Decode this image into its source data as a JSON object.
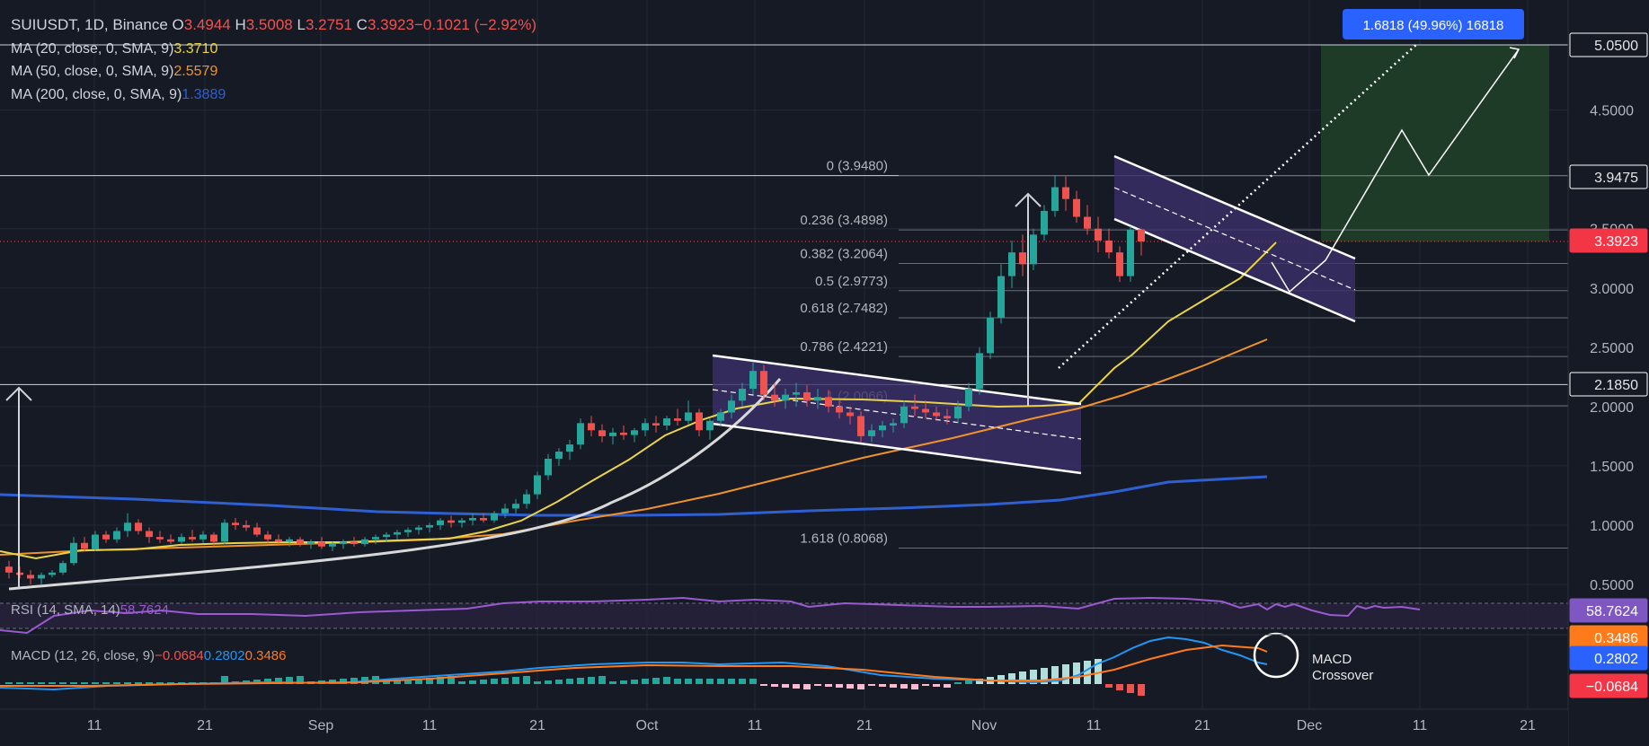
{
  "header": {
    "symbol": "SUIUSDT, 1D, Binance",
    "o_label": "O",
    "o_value": "3.4944",
    "h_label": "H",
    "h_value": "3.5008",
    "l_label": "L",
    "l_value": "3.2751",
    "c_label": "C",
    "c_value": "3.3923",
    "change": "−0.1021 (−2.92%)"
  },
  "indicators": {
    "ma20": {
      "label": "MA (20, close, 0, SMA, 9)",
      "value": "3.3710",
      "color": "#e8d34a"
    },
    "ma50": {
      "label": "MA (50, close, 0, SMA, 9)",
      "value": "2.5579",
      "color": "#f0922b"
    },
    "ma200": {
      "label": "MA (200, close, 0, SMA, 9)",
      "value": "1.3889",
      "color": "#2f5fd0"
    },
    "rsi": {
      "label": "RSI (14, SMA, 14)",
      "value": "58.7624",
      "color": "#9a5ad0"
    },
    "macd": {
      "label": "MACD (12, 26, close, 9)",
      "v1": "−0.0684",
      "v2": "0.2802",
      "v3": "0.3486"
    }
  },
  "colors": {
    "up": "#26a69a",
    "down": "#ef5350",
    "background": "#161a25",
    "target_zone": "#1e3b28",
    "channel": "#3b2f6a"
  },
  "price_axis": {
    "ticks": [
      "5.0500",
      "4.5000",
      "3.9475",
      "3.5000",
      "3.0000",
      "2.5000",
      "2.1850",
      "2.0000",
      "1.5000",
      "1.0000",
      "0.5000"
    ],
    "labels": [
      {
        "text": "5.0500",
        "style": "boxed"
      },
      {
        "text": "3.9475",
        "style": "boxed"
      },
      {
        "text": "3.3923",
        "style": "red"
      },
      {
        "text": "2.1850",
        "style": "boxed"
      },
      {
        "text": "58.7624",
        "style": "purple"
      },
      {
        "text": "0.3486",
        "style": "orange"
      },
      {
        "text": "0.2802",
        "style": "blue"
      },
      {
        "text": "−0.0684",
        "style": "red"
      }
    ]
  },
  "time_axis": [
    "11",
    "21",
    "Sep",
    "11",
    "21",
    "Oct",
    "11",
    "21",
    "Nov",
    "11",
    "21",
    "Dec",
    "11",
    "21"
  ],
  "fib_levels": [
    {
      "label": "0 (3.9480)",
      "price": 3.948
    },
    {
      "label": "0.236 (3.4898)",
      "price": 3.4898
    },
    {
      "label": "0.382 (3.2064)",
      "price": 3.2064
    },
    {
      "label": "0.5 (2.9773)",
      "price": 2.9773
    },
    {
      "label": "0.618 (2.7482)",
      "price": 2.7482
    },
    {
      "label": "0.786 (2.4221)",
      "price": 2.4221
    },
    {
      "label": "1 (2.0066)",
      "price": 2.0066
    },
    {
      "label": "1.618 (0.8068)",
      "price": 0.8068
    }
  ],
  "annotations": {
    "measure_label": "1.6818 (49.96%) 16818",
    "macd_note_line1": "MACD",
    "macd_note_line2": "Crossover"
  },
  "chart_data": {
    "type": "candlestick",
    "symbol": "SUIUSDT",
    "interval": "1D",
    "ylim": [
      0.5,
      5.05
    ],
    "price_levels": [
      5.05,
      3.9475,
      3.3923,
      2.185
    ],
    "last": {
      "open": 3.4944,
      "high": 3.5008,
      "low": 3.2751,
      "close": 3.3923
    },
    "candles": [
      [
        0.65,
        0.7,
        0.55,
        0.6
      ],
      [
        0.6,
        0.65,
        0.55,
        0.58
      ],
      [
        0.58,
        0.62,
        0.5,
        0.55
      ],
      [
        0.55,
        0.6,
        0.5,
        0.58
      ],
      [
        0.58,
        0.62,
        0.56,
        0.6
      ],
      [
        0.6,
        0.7,
        0.58,
        0.68
      ],
      [
        0.68,
        0.9,
        0.66,
        0.85
      ],
      [
        0.85,
        0.9,
        0.78,
        0.8
      ],
      [
        0.8,
        0.95,
        0.78,
        0.92
      ],
      [
        0.92,
        0.95,
        0.85,
        0.88
      ],
      [
        0.88,
        0.98,
        0.85,
        0.95
      ],
      [
        0.95,
        1.1,
        0.9,
        1.02
      ],
      [
        1.02,
        1.05,
        0.92,
        0.95
      ],
      [
        0.95,
        0.98,
        0.85,
        0.9
      ],
      [
        0.9,
        0.95,
        0.85,
        0.88
      ],
      [
        0.88,
        0.92,
        0.84,
        0.86
      ],
      [
        0.86,
        0.93,
        0.84,
        0.9
      ],
      [
        0.9,
        0.96,
        0.86,
        0.88
      ],
      [
        0.88,
        0.95,
        0.85,
        0.92
      ],
      [
        0.92,
        0.94,
        0.82,
        0.86
      ],
      [
        0.86,
        1.05,
        0.84,
        1.02
      ],
      [
        1.02,
        1.06,
        0.96,
        1.0
      ],
      [
        1.0,
        1.04,
        0.95,
        0.98
      ],
      [
        0.98,
        1.02,
        0.9,
        0.92
      ],
      [
        0.92,
        0.95,
        0.85,
        0.88
      ],
      [
        0.88,
        0.92,
        0.84,
        0.86
      ],
      [
        0.86,
        0.9,
        0.82,
        0.88
      ],
      [
        0.88,
        0.9,
        0.82,
        0.84
      ],
      [
        0.84,
        0.88,
        0.8,
        0.86
      ],
      [
        0.86,
        0.9,
        0.8,
        0.82
      ],
      [
        0.82,
        0.86,
        0.78,
        0.84
      ],
      [
        0.84,
        0.88,
        0.8,
        0.86
      ],
      [
        0.86,
        0.9,
        0.82,
        0.84
      ],
      [
        0.84,
        0.9,
        0.82,
        0.88
      ],
      [
        0.88,
        0.92,
        0.84,
        0.9
      ],
      [
        0.9,
        0.94,
        0.86,
        0.92
      ],
      [
        0.92,
        0.96,
        0.88,
        0.94
      ],
      [
        0.94,
        0.98,
        0.9,
        0.96
      ],
      [
        0.96,
        1.0,
        0.92,
        0.98
      ],
      [
        0.98,
        1.02,
        0.94,
        1.0
      ],
      [
        1.0,
        1.06,
        0.96,
        1.04
      ],
      [
        1.04,
        1.08,
        0.98,
        1.02
      ],
      [
        1.02,
        1.06,
        0.98,
        1.04
      ],
      [
        1.04,
        1.1,
        1.0,
        1.06
      ],
      [
        1.06,
        1.1,
        1.02,
        1.04
      ],
      [
        1.04,
        1.12,
        1.02,
        1.1
      ],
      [
        1.1,
        1.18,
        1.06,
        1.14
      ],
      [
        1.14,
        1.22,
        1.1,
        1.18
      ],
      [
        1.18,
        1.3,
        1.14,
        1.26
      ],
      [
        1.26,
        1.45,
        1.22,
        1.42
      ],
      [
        1.42,
        1.6,
        1.38,
        1.56
      ],
      [
        1.56,
        1.65,
        1.5,
        1.62
      ],
      [
        1.62,
        1.72,
        1.55,
        1.68
      ],
      [
        1.68,
        1.9,
        1.64,
        1.86
      ],
      [
        1.86,
        1.92,
        1.75,
        1.8
      ],
      [
        1.8,
        1.85,
        1.7,
        1.75
      ],
      [
        1.75,
        1.82,
        1.68,
        1.78
      ],
      [
        1.78,
        1.84,
        1.72,
        1.76
      ],
      [
        1.76,
        1.82,
        1.7,
        1.8
      ],
      [
        1.8,
        1.9,
        1.75,
        1.86
      ],
      [
        1.86,
        1.92,
        1.78,
        1.84
      ],
      [
        1.84,
        1.92,
        1.8,
        1.9
      ],
      [
        1.9,
        1.98,
        1.84,
        1.88
      ],
      [
        1.88,
        2.05,
        1.85,
        1.95
      ],
      [
        1.95,
        1.98,
        1.75,
        1.8
      ],
      [
        1.8,
        1.9,
        1.72,
        1.88
      ],
      [
        1.88,
        1.98,
        1.84,
        1.95
      ],
      [
        1.95,
        2.1,
        1.9,
        2.05
      ],
      [
        2.05,
        2.2,
        2.0,
        2.15
      ],
      [
        2.15,
        2.38,
        2.1,
        2.3
      ],
      [
        2.3,
        2.35,
        2.05,
        2.1
      ],
      [
        2.1,
        2.2,
        2.0,
        2.05
      ],
      [
        2.05,
        2.15,
        1.98,
        2.1
      ],
      [
        2.1,
        2.2,
        2.0,
        2.12
      ],
      [
        2.12,
        2.18,
        2.0,
        2.05
      ],
      [
        2.05,
        2.15,
        1.98,
        2.08
      ],
      [
        2.08,
        2.14,
        1.95,
        2.0
      ],
      [
        2.0,
        2.05,
        1.9,
        1.95
      ],
      [
        1.95,
        2.0,
        1.85,
        1.92
      ],
      [
        1.92,
        1.96,
        1.7,
        1.75
      ],
      [
        1.75,
        1.85,
        1.7,
        1.8
      ],
      [
        1.8,
        1.88,
        1.74,
        1.84
      ],
      [
        1.84,
        1.9,
        1.78,
        1.86
      ],
      [
        1.86,
        2.05,
        1.82,
        2.0
      ],
      [
        2.0,
        2.1,
        1.92,
        1.98
      ],
      [
        1.98,
        2.05,
        1.9,
        1.95
      ],
      [
        1.95,
        2.0,
        1.88,
        1.92
      ],
      [
        1.92,
        1.98,
        1.85,
        1.9
      ],
      [
        1.9,
        2.05,
        1.86,
        2.0
      ],
      [
        2.0,
        2.2,
        1.96,
        2.15
      ],
      [
        2.15,
        2.5,
        2.1,
        2.45
      ],
      [
        2.45,
        2.8,
        2.4,
        2.75
      ],
      [
        2.75,
        3.2,
        2.7,
        3.1
      ],
      [
        3.1,
        3.4,
        3.0,
        3.3
      ],
      [
        3.3,
        3.45,
        3.1,
        3.2
      ],
      [
        3.2,
        3.5,
        3.15,
        3.45
      ],
      [
        3.45,
        3.7,
        3.4,
        3.65
      ],
      [
        3.65,
        3.95,
        3.6,
        3.85
      ],
      [
        3.85,
        3.94,
        3.65,
        3.75
      ],
      [
        3.75,
        3.82,
        3.55,
        3.6
      ],
      [
        3.6,
        3.7,
        3.45,
        3.5
      ],
      [
        3.5,
        3.6,
        3.3,
        3.4
      ],
      [
        3.4,
        3.5,
        3.25,
        3.3
      ],
      [
        3.3,
        3.35,
        3.05,
        3.1
      ],
      [
        3.1,
        3.52,
        3.05,
        3.49
      ],
      [
        3.4944,
        3.5008,
        3.2751,
        3.3923
      ]
    ],
    "moving_averages": {
      "ma20": 3.371,
      "ma50": 2.5579,
      "ma200": 1.3889
    },
    "rsi": 58.7624,
    "macd": {
      "macd": 0.2802,
      "signal": 0.3486,
      "hist": -0.0684
    }
  }
}
